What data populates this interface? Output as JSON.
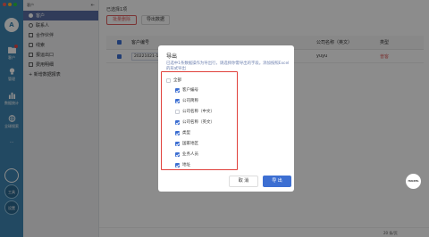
{
  "rail": {
    "avatar_letter": "A",
    "items": [
      {
        "label": "客户",
        "icon": "folder-icon"
      },
      {
        "label": "管理",
        "icon": "bulb-icon"
      },
      {
        "label": "数据统计",
        "icon": "bar-chart-icon"
      },
      {
        "label": "全球搜索",
        "icon": "globe-icon"
      }
    ],
    "more": "···",
    "bottom_btn_1": "工具",
    "bottom_btn_2": "设置"
  },
  "nav": {
    "header_label": "客户",
    "header_icon": "collapse-icon",
    "items": [
      {
        "label": "客户",
        "active": true
      },
      {
        "label": "联系人",
        "active": false
      },
      {
        "label": "合作伙伴",
        "active": false
      },
      {
        "label": "线索",
        "active": false
      },
      {
        "label": "报运出口",
        "active": false
      },
      {
        "label": "费用明细",
        "active": false
      },
      {
        "label": "+ 新增数据报表",
        "active": false
      }
    ]
  },
  "main": {
    "breadcrumb": "已选择1项",
    "btn_batch": "批量删除",
    "btn_export": "导出数据",
    "table": {
      "headers": [
        "客户编号",
        "公司名称（英文）",
        "类型"
      ],
      "row": {
        "code": "20221021-1",
        "company_en": "yuyu",
        "type": "普客"
      }
    },
    "pager": "20 条/页"
  },
  "dialog": {
    "title": "导出",
    "description": "已选中1条数据操作为导出行，请选择你需导出的字段。添加按照Excel的形式导出",
    "options": [
      {
        "label": "全部",
        "checked": false
      },
      {
        "label": "客户编号",
        "checked": true
      },
      {
        "label": "公司简称",
        "checked": true
      },
      {
        "label": "公司名称（中文）",
        "checked": false
      },
      {
        "label": "公司名称（英文）",
        "checked": true
      },
      {
        "label": "类型",
        "checked": true
      },
      {
        "label": "国家地区",
        "checked": true
      },
      {
        "label": "业务人员",
        "checked": true
      },
      {
        "label": "地址",
        "checked": true
      }
    ],
    "cancel": "取 消",
    "confirm": "导 出"
  },
  "float_badge": "HAIZEL",
  "colors": {
    "rail": "#3f86b2",
    "accent": "#3d6fd2",
    "highlight_border": "#e0403b",
    "nav_active": "#5a6ea5"
  }
}
